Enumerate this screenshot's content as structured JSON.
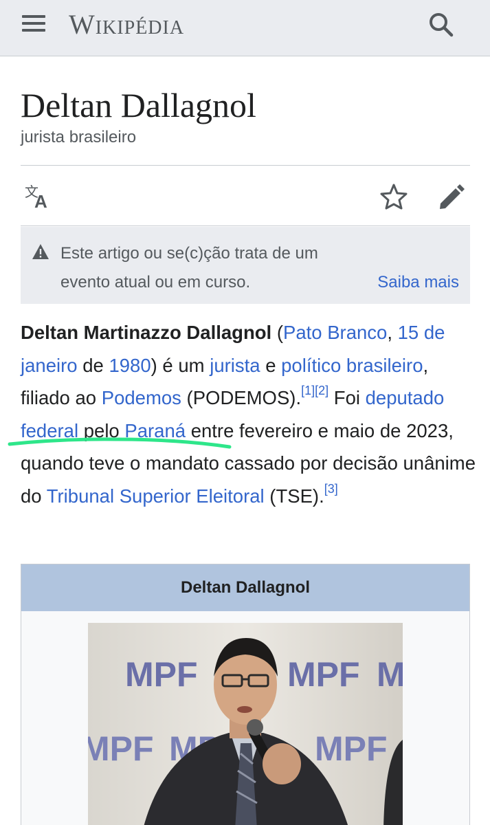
{
  "header": {
    "wordmark": "Wikipédia",
    "menu_icon": "hamburger-menu-icon",
    "search_icon": "search-icon"
  },
  "page": {
    "title": "Deltan Dallagnol",
    "subtitle": "jurista brasileiro"
  },
  "actions": {
    "language_icon": "translate-icon",
    "watch_icon": "star-icon",
    "edit_icon": "pencil-icon"
  },
  "notice": {
    "icon": "warning-icon",
    "text": "Este artigo ou se(c)ção trata de um evento atual ou em curso.",
    "link": "Saiba mais"
  },
  "lead": {
    "name": "Deltan Martinazzo Dallagnol",
    "t1": " (",
    "birthplace": "Pato Branco",
    "t2": ", ",
    "birth_date": "15 de janeiro",
    "t3": " de ",
    "birth_year": "1980",
    "t4": ") é um ",
    "profession": "jurista",
    "t5": " e ",
    "political": "político brasileiro",
    "t6": ", filiado ao ",
    "party": "Podemos",
    "t7": " (PODEMOS).",
    "ref1": "[1]",
    "ref2": "[2]",
    "t8": " Foi ",
    "office": "deputado federal",
    "t9": " pelo ",
    "state": "Paraná",
    "t10": " entre fevereiro e maio de 2023, quando teve o mandato cassado por decisão unânime do ",
    "court": "Tribunal Superior Eleitoral",
    "t11": " (TSE).",
    "ref3": "[3]"
  },
  "infobox": {
    "title": "Deltan Dallagnol",
    "photo_backdrop_text": [
      "MPF",
      "MPF",
      "MPF",
      "MPF",
      "MPF",
      "MPF"
    ]
  },
  "colors": {
    "link": "#3366cc",
    "header_bg": "#eaecf0",
    "infobox_title_bg": "#b0c4de",
    "highlight_marker": "#2ee68a"
  }
}
